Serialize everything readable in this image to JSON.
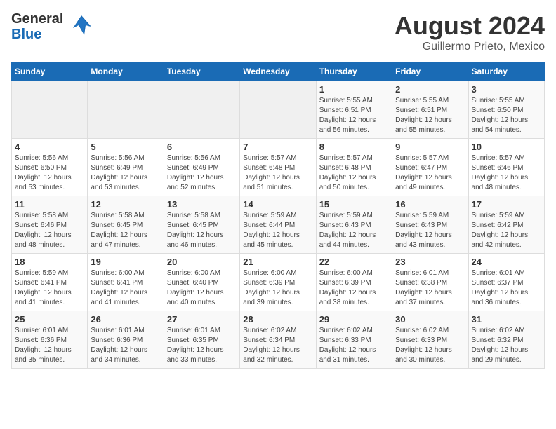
{
  "header": {
    "logo_general": "General",
    "logo_blue": "Blue",
    "title": "August 2024",
    "subtitle": "Guillermo Prieto, Mexico"
  },
  "calendar": {
    "days_of_week": [
      "Sunday",
      "Monday",
      "Tuesday",
      "Wednesday",
      "Thursday",
      "Friday",
      "Saturday"
    ],
    "weeks": [
      [
        {
          "day": "",
          "info": ""
        },
        {
          "day": "",
          "info": ""
        },
        {
          "day": "",
          "info": ""
        },
        {
          "day": "",
          "info": ""
        },
        {
          "day": "1",
          "info": "Sunrise: 5:55 AM\nSunset: 6:51 PM\nDaylight: 12 hours\nand 56 minutes."
        },
        {
          "day": "2",
          "info": "Sunrise: 5:55 AM\nSunset: 6:51 PM\nDaylight: 12 hours\nand 55 minutes."
        },
        {
          "day": "3",
          "info": "Sunrise: 5:55 AM\nSunset: 6:50 PM\nDaylight: 12 hours\nand 54 minutes."
        }
      ],
      [
        {
          "day": "4",
          "info": "Sunrise: 5:56 AM\nSunset: 6:50 PM\nDaylight: 12 hours\nand 53 minutes."
        },
        {
          "day": "5",
          "info": "Sunrise: 5:56 AM\nSunset: 6:49 PM\nDaylight: 12 hours\nand 53 minutes."
        },
        {
          "day": "6",
          "info": "Sunrise: 5:56 AM\nSunset: 6:49 PM\nDaylight: 12 hours\nand 52 minutes."
        },
        {
          "day": "7",
          "info": "Sunrise: 5:57 AM\nSunset: 6:48 PM\nDaylight: 12 hours\nand 51 minutes."
        },
        {
          "day": "8",
          "info": "Sunrise: 5:57 AM\nSunset: 6:48 PM\nDaylight: 12 hours\nand 50 minutes."
        },
        {
          "day": "9",
          "info": "Sunrise: 5:57 AM\nSunset: 6:47 PM\nDaylight: 12 hours\nand 49 minutes."
        },
        {
          "day": "10",
          "info": "Sunrise: 5:57 AM\nSunset: 6:46 PM\nDaylight: 12 hours\nand 48 minutes."
        }
      ],
      [
        {
          "day": "11",
          "info": "Sunrise: 5:58 AM\nSunset: 6:46 PM\nDaylight: 12 hours\nand 48 minutes."
        },
        {
          "day": "12",
          "info": "Sunrise: 5:58 AM\nSunset: 6:45 PM\nDaylight: 12 hours\nand 47 minutes."
        },
        {
          "day": "13",
          "info": "Sunrise: 5:58 AM\nSunset: 6:45 PM\nDaylight: 12 hours\nand 46 minutes."
        },
        {
          "day": "14",
          "info": "Sunrise: 5:59 AM\nSunset: 6:44 PM\nDaylight: 12 hours\nand 45 minutes."
        },
        {
          "day": "15",
          "info": "Sunrise: 5:59 AM\nSunset: 6:43 PM\nDaylight: 12 hours\nand 44 minutes."
        },
        {
          "day": "16",
          "info": "Sunrise: 5:59 AM\nSunset: 6:43 PM\nDaylight: 12 hours\nand 43 minutes."
        },
        {
          "day": "17",
          "info": "Sunrise: 5:59 AM\nSunset: 6:42 PM\nDaylight: 12 hours\nand 42 minutes."
        }
      ],
      [
        {
          "day": "18",
          "info": "Sunrise: 5:59 AM\nSunset: 6:41 PM\nDaylight: 12 hours\nand 41 minutes."
        },
        {
          "day": "19",
          "info": "Sunrise: 6:00 AM\nSunset: 6:41 PM\nDaylight: 12 hours\nand 41 minutes."
        },
        {
          "day": "20",
          "info": "Sunrise: 6:00 AM\nSunset: 6:40 PM\nDaylight: 12 hours\nand 40 minutes."
        },
        {
          "day": "21",
          "info": "Sunrise: 6:00 AM\nSunset: 6:39 PM\nDaylight: 12 hours\nand 39 minutes."
        },
        {
          "day": "22",
          "info": "Sunrise: 6:00 AM\nSunset: 6:39 PM\nDaylight: 12 hours\nand 38 minutes."
        },
        {
          "day": "23",
          "info": "Sunrise: 6:01 AM\nSunset: 6:38 PM\nDaylight: 12 hours\nand 37 minutes."
        },
        {
          "day": "24",
          "info": "Sunrise: 6:01 AM\nSunset: 6:37 PM\nDaylight: 12 hours\nand 36 minutes."
        }
      ],
      [
        {
          "day": "25",
          "info": "Sunrise: 6:01 AM\nSunset: 6:36 PM\nDaylight: 12 hours\nand 35 minutes."
        },
        {
          "day": "26",
          "info": "Sunrise: 6:01 AM\nSunset: 6:36 PM\nDaylight: 12 hours\nand 34 minutes."
        },
        {
          "day": "27",
          "info": "Sunrise: 6:01 AM\nSunset: 6:35 PM\nDaylight: 12 hours\nand 33 minutes."
        },
        {
          "day": "28",
          "info": "Sunrise: 6:02 AM\nSunset: 6:34 PM\nDaylight: 12 hours\nand 32 minutes."
        },
        {
          "day": "29",
          "info": "Sunrise: 6:02 AM\nSunset: 6:33 PM\nDaylight: 12 hours\nand 31 minutes."
        },
        {
          "day": "30",
          "info": "Sunrise: 6:02 AM\nSunset: 6:33 PM\nDaylight: 12 hours\nand 30 minutes."
        },
        {
          "day": "31",
          "info": "Sunrise: 6:02 AM\nSunset: 6:32 PM\nDaylight: 12 hours\nand 29 minutes."
        }
      ]
    ]
  }
}
